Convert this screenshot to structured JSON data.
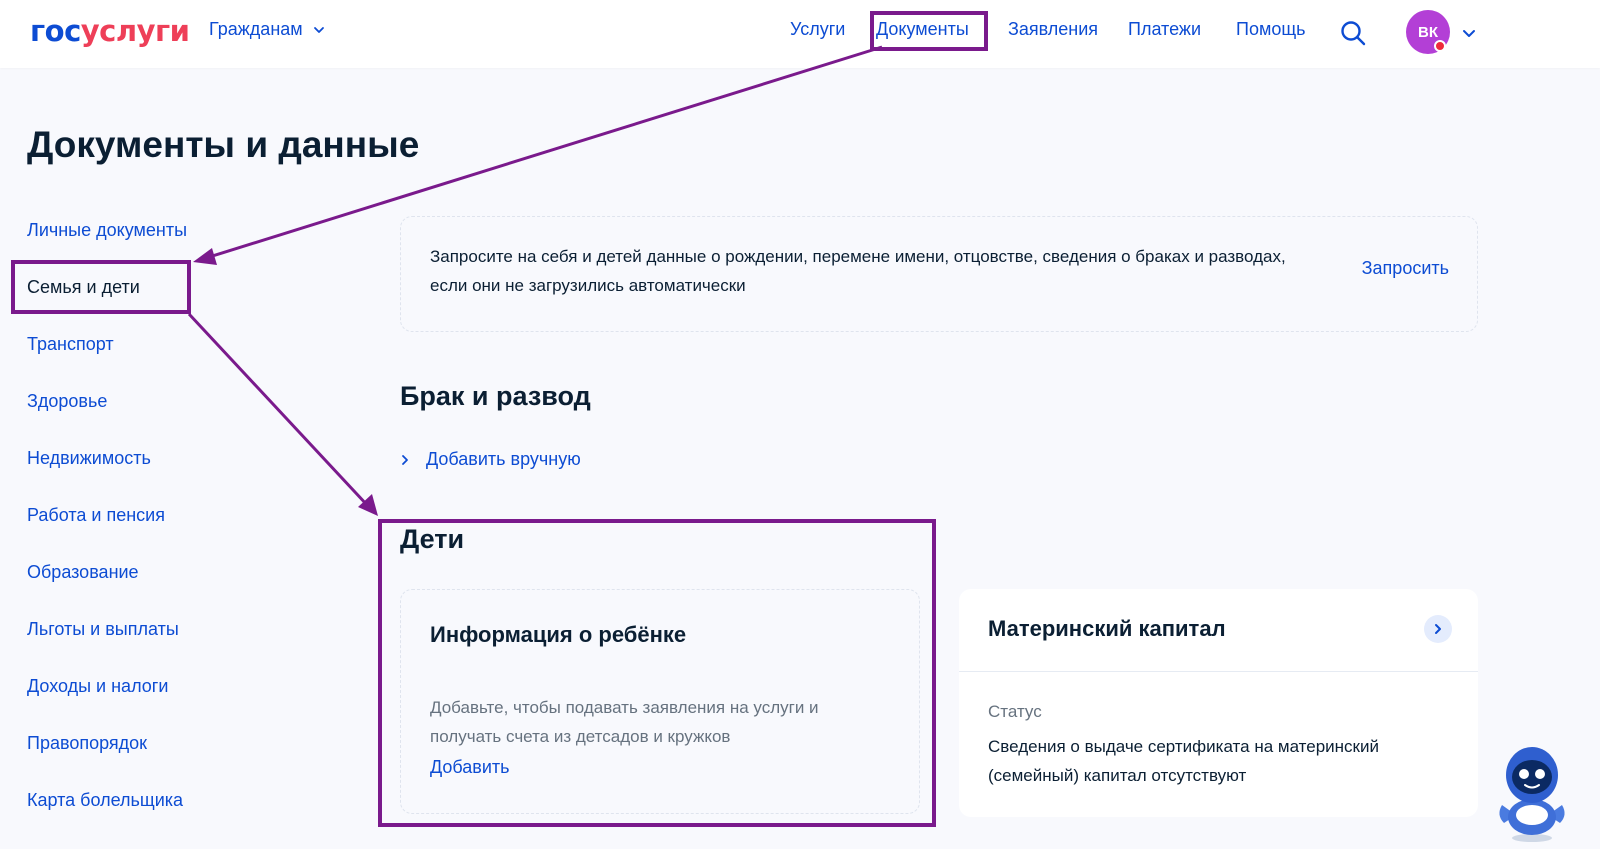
{
  "header": {
    "logo_part1": "гос",
    "logo_part2": "услуги",
    "audience": "Гражданам",
    "nav": [
      "Услуги",
      "Документы",
      "Заявления",
      "Платежи",
      "Помощь"
    ],
    "avatar_initials": "ВК"
  },
  "page_title": "Документы и данные",
  "sidebar": {
    "items": [
      "Личные документы",
      "Семья и дети",
      "Транспорт",
      "Здоровье",
      "Недвижимость",
      "Работа и пенсия",
      "Образование",
      "Льготы и выплаты",
      "Доходы и налоги",
      "Правопорядок",
      "Карта болельщика"
    ],
    "active": "Семья и дети"
  },
  "request_card": {
    "text": "Запросите на себя и детей данные о рождении, перемене имени, отцовстве, сведения о браках и разводах, если они не загрузились автоматически",
    "button": "Запросить"
  },
  "marriage": {
    "title": "Брак и развод",
    "add_manual": "Добавить вручную"
  },
  "children": {
    "title": "Дети",
    "card_title": "Информация о ребёнке",
    "card_description": "Добавьте, чтобы подавать заявления на услуги и получать счета из детсадов и кружков",
    "add_link": "Добавить"
  },
  "maternity_capital": {
    "title": "Материнский капитал",
    "status_label": "Статус",
    "status_text": "Сведения о выдаче сертификата на материнский (семейный) капитал отсутствуют"
  },
  "colors": {
    "link": "#0d4cd3",
    "annotation": "#7a1a8c",
    "avatar": "#b33fd6",
    "logo_accent": "#ee3f58"
  }
}
